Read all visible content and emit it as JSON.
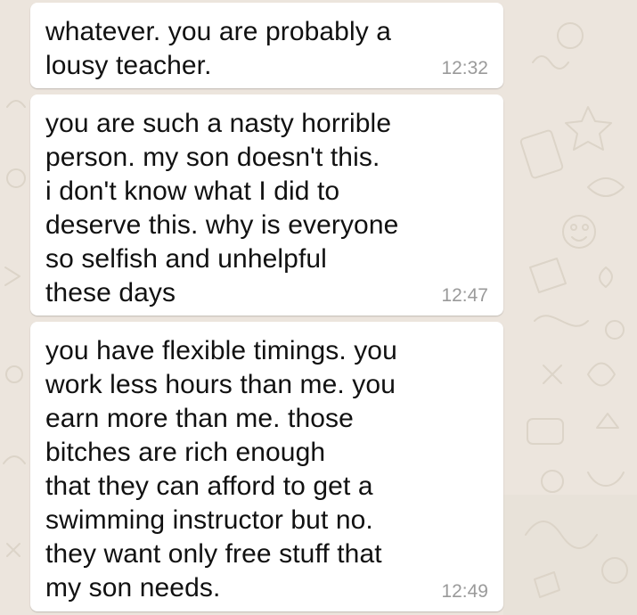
{
  "theme": {
    "wallpaper_color": "#ece5dd",
    "bubble_color": "#ffffff",
    "text_color": "#111111",
    "time_color": "#9a9a9a"
  },
  "messages": [
    {
      "text": "whatever. you are probably a\nlousy teacher.",
      "time": "12:32"
    },
    {
      "text": "you are such a nasty horrible\nperson. my son doesn't this.\ni don't know what I did to\ndeserve this. why is everyone\nso selfish and unhelpful\nthese days",
      "time": "12:47"
    },
    {
      "text": "you have flexible timings. you\nwork less hours than me. you\nearn more than me. those\nbitches are rich enough\nthat they can afford to get a\nswimming instructor but no.\nthey want only free stuff that\nmy son needs.",
      "time": "12:49"
    }
  ]
}
